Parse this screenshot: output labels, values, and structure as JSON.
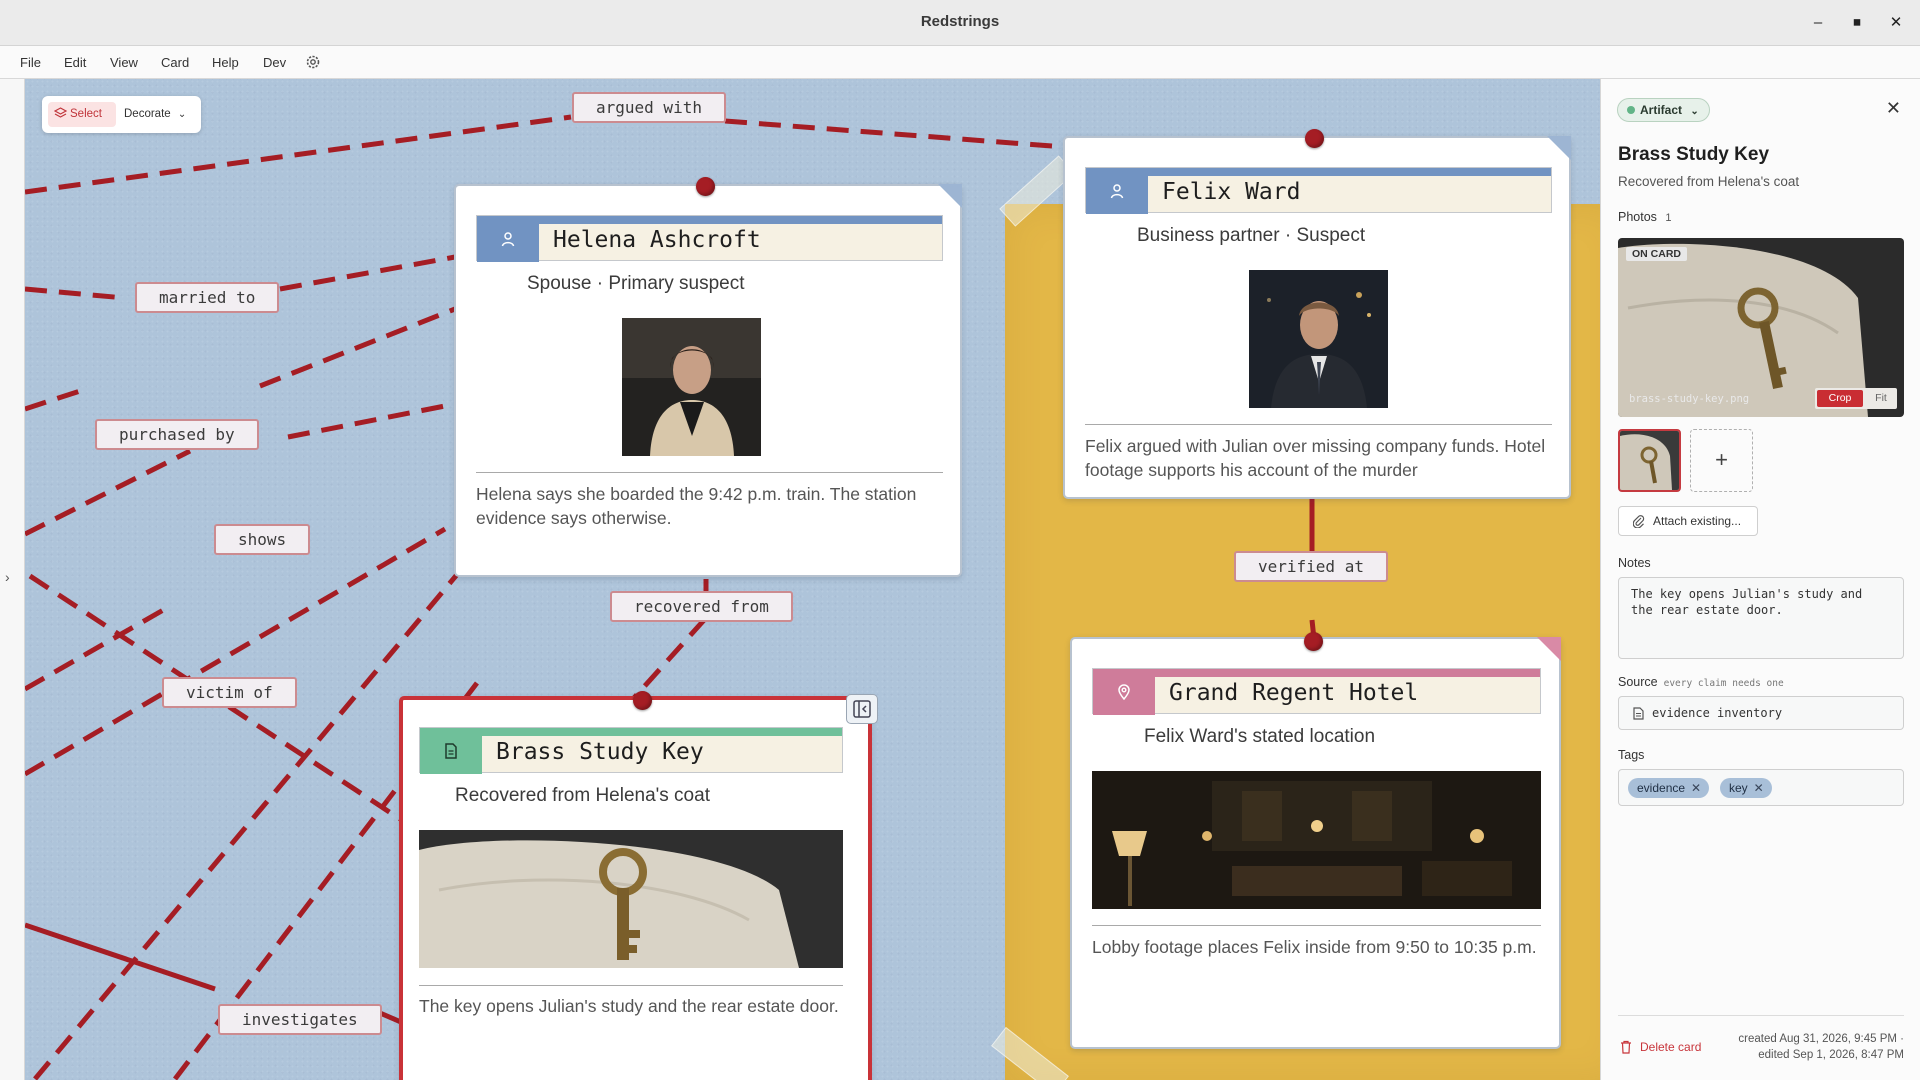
{
  "window": {
    "title": "Redstrings"
  },
  "menu": [
    "File",
    "Edit",
    "View",
    "Card",
    "Help",
    "Dev"
  ],
  "toolbar": {
    "select_label": "Select",
    "decorate_label": "Decorate"
  },
  "edge_labels": {
    "argued_with": "argued with",
    "married_to": "married to",
    "purchased_by": "purchased by",
    "shows": "shows",
    "victim_of": "victim of",
    "recovered_from": "recovered from",
    "verified_at": "verified at",
    "investigates": "investigates"
  },
  "cards": {
    "helena": {
      "name": "Helena Ashcroft",
      "subtitle": "Spouse · Primary suspect",
      "description": "Helena says she boarded the 9:42 p.m. train. The station evidence says otherwise.",
      "icon": "person-icon"
    },
    "felix": {
      "name": "Felix Ward",
      "subtitle": "Business partner · Suspect",
      "description": "Felix argued with Julian over missing company funds. Hotel footage supports his account of the murder",
      "icon": "person-icon"
    },
    "key": {
      "name": "Brass Study Key",
      "subtitle": "Recovered from Helena's coat",
      "description": "The key opens Julian's study and the rear estate door.",
      "icon": "document-icon"
    },
    "hotel": {
      "name": "Grand Regent Hotel",
      "subtitle": "Felix Ward's stated location",
      "description": "Lobby footage places Felix inside from 9:50 to 10:35 p.m.",
      "icon": "location-pin-icon"
    }
  },
  "colors": {
    "person": "#7193c2",
    "artifact": "#6fc09a",
    "place": "#cf7c9a",
    "string": "#a51d24",
    "board": "#aec4da",
    "group": "#e3b747"
  },
  "panel": {
    "type_label": "Artifact",
    "title": "Brass Study Key",
    "subtitle": "Recovered from Helena's coat",
    "photos_label": "Photos",
    "photos_count": "1",
    "on_card_badge": "ON CARD",
    "photo_filename": "brass-study-key.png",
    "crop_label": "Crop",
    "fit_label": "Fit",
    "add_symbol": "+",
    "attach_label": "Attach existing...",
    "notes_label": "Notes",
    "notes_value": "The key opens Julian's study and the rear estate door.",
    "source_label": "Source",
    "source_hint": "every claim needs one",
    "source_value": "evidence inventory",
    "tags_label": "Tags",
    "tags": [
      "evidence",
      "key"
    ],
    "delete_label": "Delete card",
    "created": "created Aug 31, 2026, 9:45 PM ·",
    "edited": "edited Sep 1, 2026, 8:47 PM"
  }
}
